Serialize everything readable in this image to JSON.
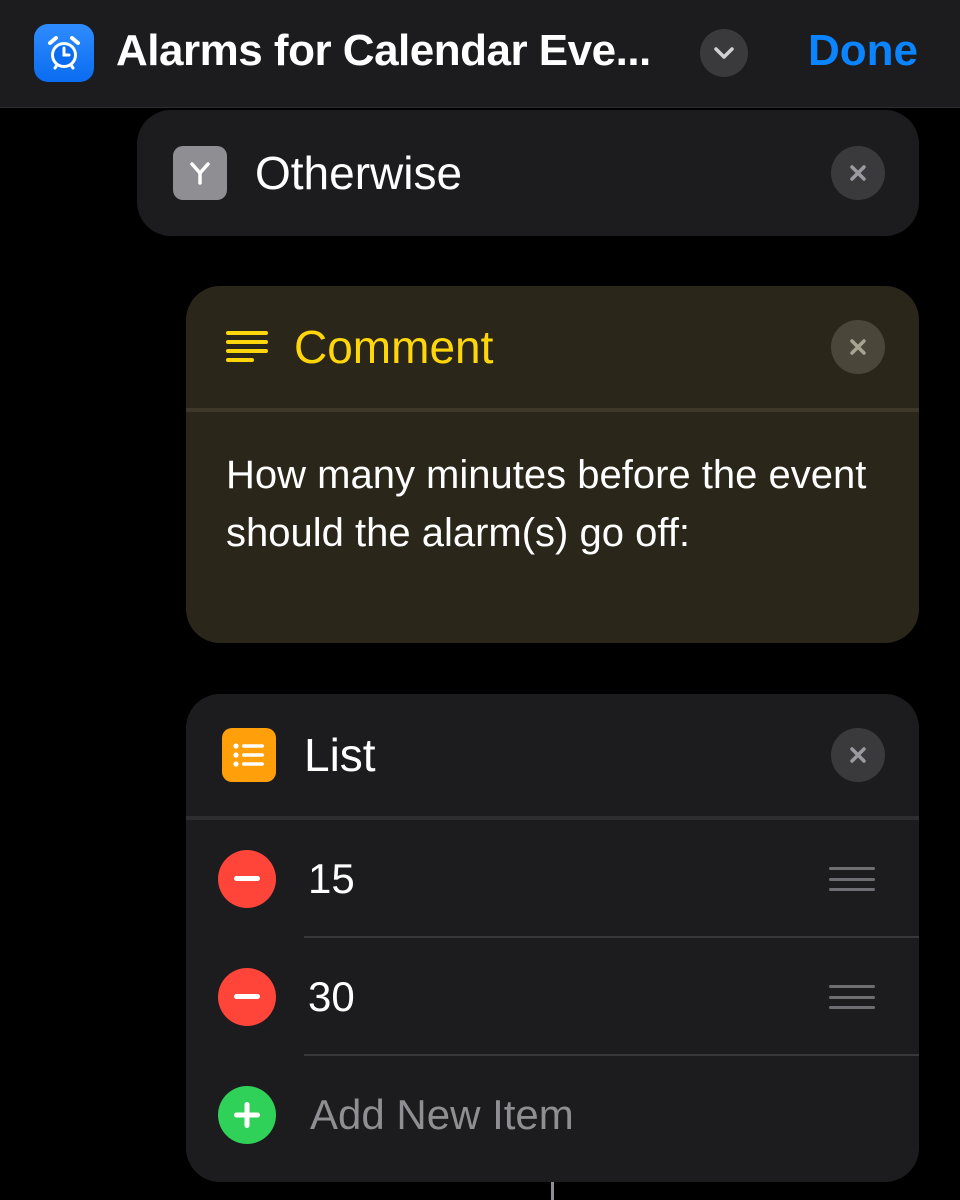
{
  "header": {
    "app_icon": "alarm-clock-icon",
    "title": "Alarms for Calendar Eve...",
    "chevron_icon": "chevron-down-icon",
    "done_label": "Done",
    "colors": {
      "accent": "#0a84ff",
      "app_icon_bg": "#0a6cf0"
    }
  },
  "otherwise_block": {
    "icon": "branch-icon",
    "title": "Otherwise",
    "close_icon": "close-icon"
  },
  "comment_block": {
    "icon": "text-lines-icon",
    "title": "Comment",
    "text": "How many minutes before the event should the alarm(s) go off:",
    "close_icon": "close-icon",
    "colors": {
      "title": "#ffd60a",
      "background": "#2b261a"
    }
  },
  "list_block": {
    "icon": "list-icon",
    "title": "List",
    "close_icon": "close-icon",
    "items": [
      {
        "value": "15",
        "remove_icon": "minus-circle-icon",
        "reorder_icon": "drag-handle-icon"
      },
      {
        "value": "30",
        "remove_icon": "minus-circle-icon",
        "reorder_icon": "drag-handle-icon"
      }
    ],
    "add_label": "Add New Item",
    "add_icon": "plus-circle-icon",
    "colors": {
      "icon_bg": "#ff9f0a",
      "remove": "#ff453a",
      "add": "#30d158"
    }
  }
}
